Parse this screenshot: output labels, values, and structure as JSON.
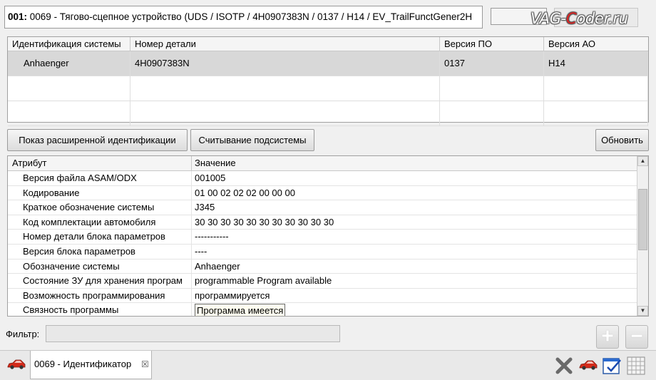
{
  "header": {
    "address": "001:",
    "title": " 0069 - Тягово-сцепное устройство  (UDS / ISOTP / 4H0907383N / 0137 / H14 / EV_TrailFunctGener2H",
    "watermark_prefix": "VAG-",
    "watermark_c": "C",
    "watermark_suffix": "oder.ru"
  },
  "id_table": {
    "columns": [
      "Идентификация системы",
      "Номер детали",
      "Версия ПО",
      "Версия АО"
    ],
    "rows": [
      [
        "Anhaenger",
        "4H0907383N",
        "0137",
        "H14"
      ],
      [
        "",
        "",
        "",
        ""
      ],
      [
        "",
        "",
        "",
        ""
      ]
    ]
  },
  "buttons": {
    "extended_id": "Показ расширенной идентификации",
    "read_subsystem": "Считывание подсистемы",
    "refresh": "Обновить"
  },
  "attr_table": {
    "columns": [
      "Атрибут",
      "Значение"
    ],
    "rows": [
      [
        "Версия файла ASAM/ODX",
        "001005"
      ],
      [
        "Кодирование",
        "01 00 02 02 02 00 00 00"
      ],
      [
        "Краткое обозначение системы",
        "J345"
      ],
      [
        "Код комплектации автомобиля",
        "30 30 30 30 30 30 30 30 30 30 30"
      ],
      [
        "Номер детали блока параметров",
        "-----------"
      ],
      [
        "Версия блока параметров",
        "----"
      ],
      [
        "Обозначение системы",
        "Anhaenger"
      ],
      [
        "Состояние ЗУ для хранения програм",
        "programmable Program available"
      ],
      [
        "Возможность программирования",
        "программируется"
      ],
      [
        "Связность программы",
        "Программа имеется"
      ]
    ]
  },
  "filter": {
    "label": "Фильтр:",
    "value": ""
  },
  "bottom": {
    "tab_label": "0069 - Идентификатор",
    "tab_close": "☒"
  },
  "icons": {
    "car_color": "#d42a1a",
    "plus": "+",
    "minus": "−"
  }
}
